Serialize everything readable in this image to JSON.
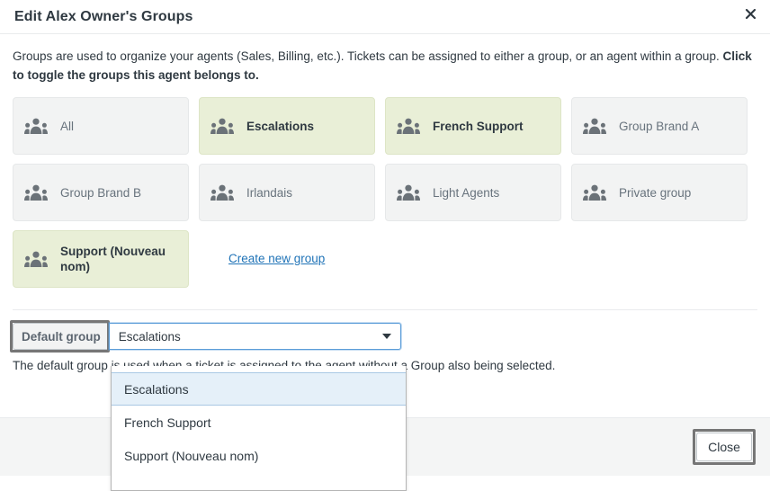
{
  "header": {
    "title": "Edit Alex Owner's Groups",
    "close_icon": "close-x-icon"
  },
  "body": {
    "intro_part1": "Groups are used to organize your agents (Sales, Billing, etc.). Tickets can be assigned to either a group, or an agent within a group. ",
    "intro_bold": "Click to toggle the groups this agent belongs to.",
    "group_icon": "group-people-icon",
    "groups": [
      {
        "label": "All",
        "selected": false
      },
      {
        "label": "Escalations",
        "selected": true
      },
      {
        "label": "French Support",
        "selected": true
      },
      {
        "label": "Group Brand A",
        "selected": false
      },
      {
        "label": "Group Brand B",
        "selected": false
      },
      {
        "label": "Irlandais",
        "selected": false
      },
      {
        "label": "Light Agents",
        "selected": false
      },
      {
        "label": "Private group",
        "selected": false
      }
    ],
    "support_group": {
      "label": "Support (Nouveau nom)",
      "selected": true
    },
    "create_new_group_link": "Create new group",
    "default_group": {
      "label": "Default group",
      "selected_value": "Escalations",
      "caret_icon": "chevron-down-icon",
      "options": [
        {
          "label": "Escalations",
          "highlighted": true
        },
        {
          "label": "French Support",
          "highlighted": false
        },
        {
          "label": "Support (Nouveau nom)",
          "highlighted": false
        }
      ]
    },
    "helper_text": "The default group is used when a ticket is assigned to the agent without a Group also being selected."
  },
  "footer": {
    "close_label": "Close"
  },
  "colors": {
    "selected_tile_bg": "#e9efd7",
    "tile_bg": "#f2f3f3",
    "link": "#1f73b7",
    "text": "#2f3941",
    "muted_text": "#68737d",
    "focus_blue": "#5b9dd9",
    "focus_dark": "#767676",
    "dropdown_highlight": "#e5f0f9"
  }
}
